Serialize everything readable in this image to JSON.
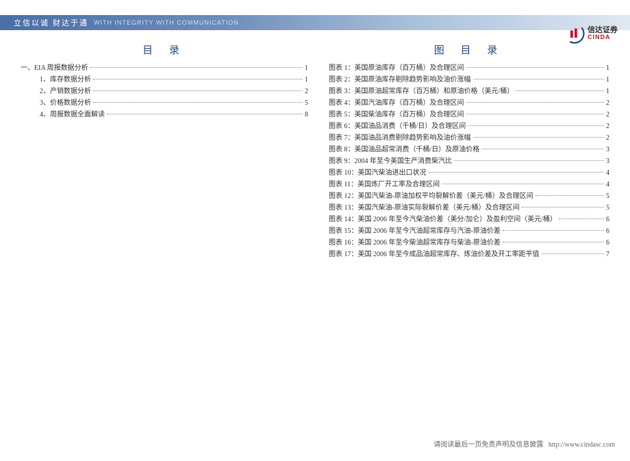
{
  "header": {
    "motto_cn": "立信以诚  财达于通",
    "motto_en": "WITH INTEGRITY   WITH COMMUNICATION"
  },
  "logo": {
    "name_cn": "信达证券",
    "name_en": "CINDA"
  },
  "toc": {
    "title": "目 录",
    "items": [
      {
        "label": "一、EIA 周报数据分析",
        "page": "1",
        "indent": 0
      },
      {
        "label": "1、库存数据分析",
        "page": "1",
        "indent": 1
      },
      {
        "label": "2、产销数据分析",
        "page": "2",
        "indent": 1
      },
      {
        "label": "3、价格数据分析",
        "page": "5",
        "indent": 1
      },
      {
        "label": "4、周报数据全面解读",
        "page": "8",
        "indent": 1
      }
    ]
  },
  "figures": {
    "title": "图 目 录",
    "items": [
      {
        "label": "图表 1：美国原油库存（百万桶）及合理区间",
        "page": "1"
      },
      {
        "label": "图表 2：美国原油库存剔除趋势影响及油价涨幅",
        "page": "1"
      },
      {
        "label": "图表 3：美国原油超常库存（百万桶）和原油价格（美元/桶）",
        "page": "1"
      },
      {
        "label": "图表 4：美国汽油库存（百万桶）及合理区间",
        "page": "2"
      },
      {
        "label": "图表 5：美国柴油库存（百万桶）及合理区间",
        "page": "2"
      },
      {
        "label": "图表 6：美国油品消费（千桶/日）及合理区间",
        "page": "2"
      },
      {
        "label": "图表 7：美国油品消费剔除趋势影响及油价涨幅",
        "page": "2"
      },
      {
        "label": "图表 8：美国油品超常消费（千桶/日）及原油价格",
        "page": "3"
      },
      {
        "label": "图表 9：2004 年至今美国生产消费柴汽比",
        "page": "3"
      },
      {
        "label": "图表 10：美国汽柴油进出口状况",
        "page": "4"
      },
      {
        "label": "图表 11：美国炼厂开工率及合理区间",
        "page": "4"
      },
      {
        "label": "图表 12：美国汽柴油-原油加权平均裂解价差（美元/桶）及合理区间",
        "page": "5"
      },
      {
        "label": "图表 13：美国汽柴油-原油实际裂解价差（美元/桶）及合理区间",
        "page": "5"
      },
      {
        "label": "图表 14：美国 2006 年至今汽柴油价差（美分/加仑）及盈利空间（美元/桶）",
        "page": "6"
      },
      {
        "label": "图表 15：美国 2006 年至今汽油超常库存与汽油-原油价差",
        "page": "6"
      },
      {
        "label": "图表 16：美国 2006 年至今柴油超常库存与柴油-原油价差",
        "page": "6"
      },
      {
        "label": "图表 17：美国 2006 年至今成品油超常库存、炼油价差及开工率距平值",
        "page": "7"
      }
    ]
  },
  "footer": {
    "text": "请阅读最后一页免责声明及信息披露",
    "url": "http://www.cindasc.com"
  }
}
